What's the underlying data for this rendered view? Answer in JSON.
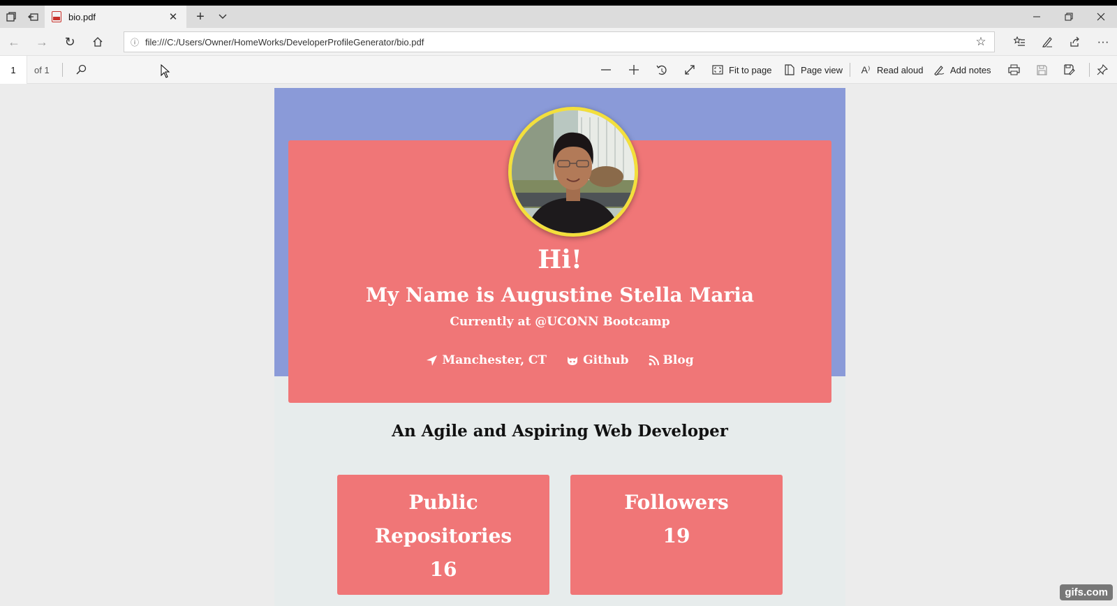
{
  "browser": {
    "tab": {
      "title": "bio.pdf"
    },
    "address": {
      "url": "file:///C:/Users/Owner/HomeWorks/DeveloperProfileGenerator/bio.pdf"
    }
  },
  "pdf_toolbar": {
    "page_number": "1",
    "page_count": "of 1",
    "fit_to_page": "Fit to page",
    "page_view": "Page view",
    "read_aloud": "Read aloud",
    "add_notes": "Add notes"
  },
  "profile": {
    "greeting": "Hi!",
    "name": "My Name is Augustine Stella Maria",
    "current": "Currently at @UCONN Bootcamp",
    "location": "Manchester, CT",
    "github": "Github",
    "blog": "Blog",
    "tagline": "An Agile and Aspiring Web Developer",
    "stats": [
      {
        "label": "Public Repositories",
        "value": "16"
      },
      {
        "label": "Followers",
        "value": "19"
      }
    ]
  },
  "colors": {
    "banner": "#8a9ad8",
    "card": "#f07677",
    "avatar_ring": "#f3df3c",
    "page_bg": "#e7ecec"
  },
  "watermark": "gifs.com"
}
